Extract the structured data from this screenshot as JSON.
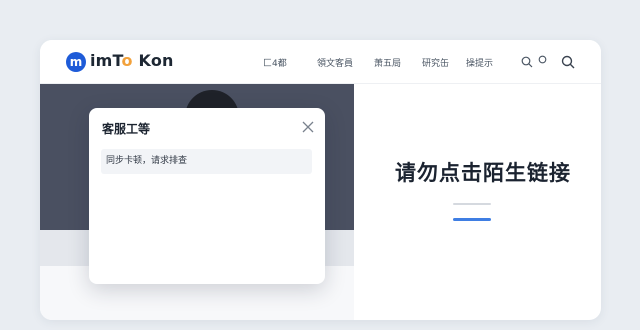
{
  "header": {
    "logo_mark": "m",
    "logo_text_a": "imT",
    "logo_text_accent": "o",
    "logo_text_b": " Kon",
    "nav": [
      "匚4都",
      "領文客員",
      "萧五局",
      "研究缶",
      "操提示"
    ],
    "icons": [
      "search-icon",
      "notification-icon",
      "search-icon"
    ]
  },
  "hero": {
    "headline": "请勿点击陌生链接"
  },
  "modal": {
    "title": "客服工等",
    "message": "同步卡顿，请求排查",
    "close_icon": "close-icon"
  },
  "colors": {
    "background": "#e9edf2",
    "brand": "#1e5bd8",
    "brand_accent": "#f2a13b",
    "panel_dark": "#4a5061",
    "underline": "#3f7ee3"
  }
}
